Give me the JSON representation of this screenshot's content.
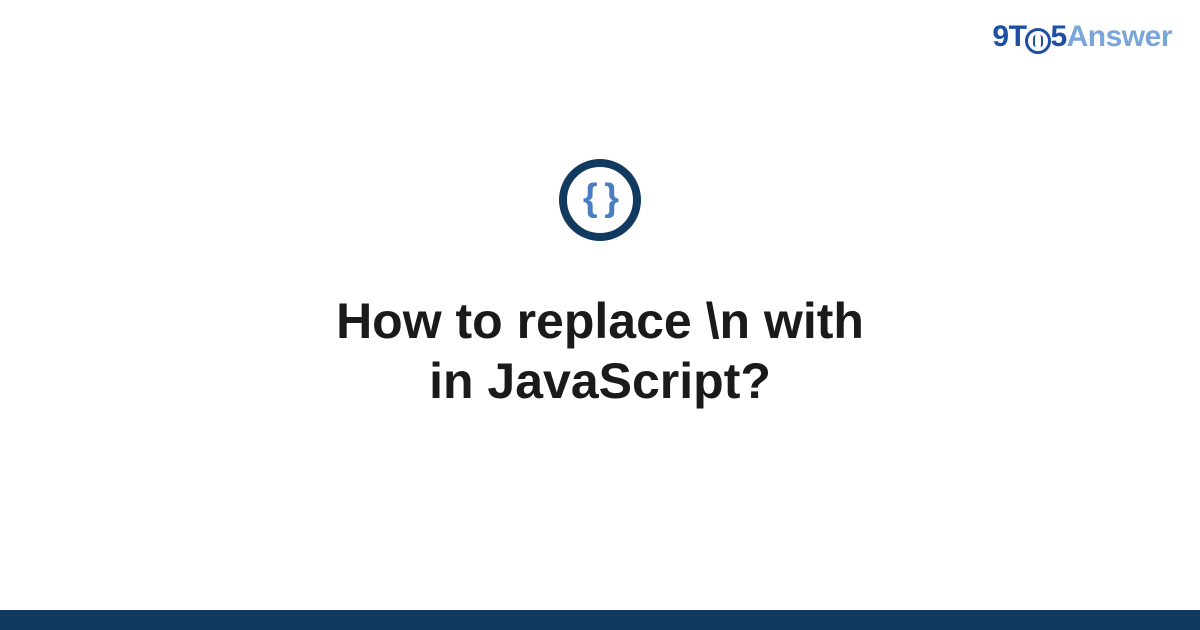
{
  "logo": {
    "prefix": "9T",
    "suffix": "5",
    "brand": "Answer"
  },
  "icon": {
    "braces": "{ }"
  },
  "main": {
    "title": "How to replace \\n with\nin JavaScript?"
  }
}
